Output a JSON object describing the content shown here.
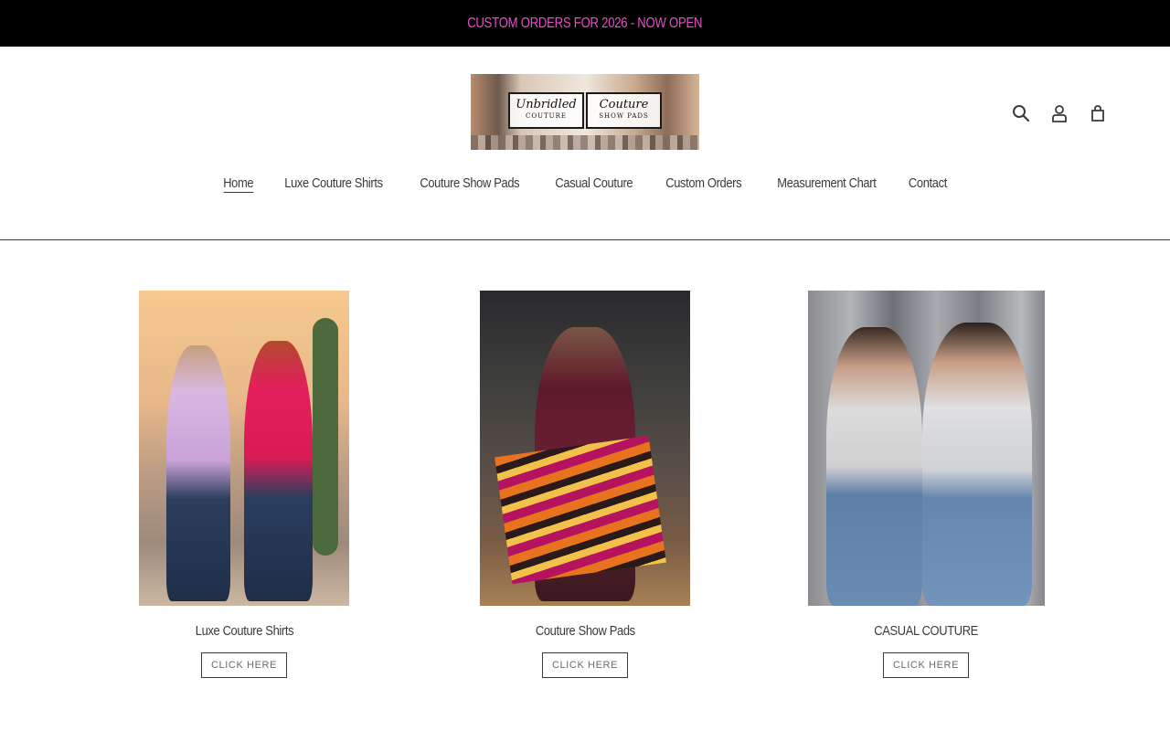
{
  "announcement": {
    "text": "CUSTOM ORDERS FOR 2026 - NOW OPEN"
  },
  "header": {
    "logo": {
      "left_text": "Unbridled",
      "left_sub": "COUTURE",
      "right_text": "Couture",
      "right_sub": "SHOW PADS"
    },
    "icons": [
      "search-icon",
      "account-icon",
      "cart-icon"
    ]
  },
  "nav": {
    "items": [
      {
        "label": "Home",
        "active": true
      },
      {
        "label": "Luxe Couture Shirts"
      },
      {
        "label": "Couture Show Pads"
      },
      {
        "label": "Casual Couture"
      },
      {
        "label": "Custom Orders"
      },
      {
        "label": "Measurement Chart"
      },
      {
        "label": "Contact"
      }
    ]
  },
  "collections": [
    {
      "title": "Luxe Couture Shirts",
      "button": "CLICK HERE"
    },
    {
      "title": "Couture Show Pads",
      "button": "CLICK HERE"
    },
    {
      "title": "CASUAL COUTURE",
      "button": "CLICK HERE"
    }
  ],
  "colors": {
    "announcement_bg": "#000000",
    "announcement_text": "#e64fc8",
    "text": "#3a3a3a"
  }
}
